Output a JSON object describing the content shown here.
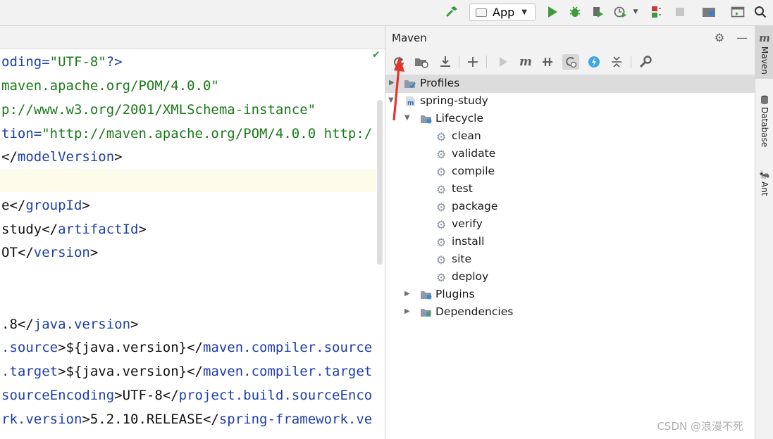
{
  "toolbar": {
    "run_config": "App"
  },
  "editor": {
    "lines": [
      [
        {
          "t": "tag",
          "v": "oding="
        },
        {
          "t": "str",
          "v": "\"UTF-8\""
        },
        {
          "t": "tag",
          "v": "?>"
        }
      ],
      [
        {
          "t": "str",
          "v": "maven.apache.org/POM/4.0.0\""
        }
      ],
      [
        {
          "t": "str",
          "v": "p://www.w3.org/2001/XMLSchema-instance\""
        }
      ],
      [
        {
          "t": "tag",
          "v": "tion="
        },
        {
          "t": "str",
          "v": "\"http://maven.apache.org/POM/4.0.0 http:/"
        }
      ],
      [
        {
          "t": "txt",
          "v": "</"
        },
        {
          "t": "tag",
          "v": "modelVersion"
        },
        {
          "t": "txt",
          "v": ">"
        }
      ],
      [
        {
          "t": "txt",
          "v": ""
        }
      ],
      [
        {
          "t": "txt",
          "v": "e</"
        },
        {
          "t": "tag",
          "v": "groupId"
        },
        {
          "t": "txt",
          "v": ">"
        }
      ],
      [
        {
          "t": "txt",
          "v": "study</"
        },
        {
          "t": "tag",
          "v": "artifactId"
        },
        {
          "t": "txt",
          "v": ">"
        }
      ],
      [
        {
          "t": "txt",
          "v": "OT</"
        },
        {
          "t": "tag",
          "v": "version"
        },
        {
          "t": "txt",
          "v": ">"
        }
      ],
      [
        {
          "t": "txt",
          "v": ""
        }
      ],
      [
        {
          "t": "txt",
          "v": ""
        }
      ],
      [
        {
          "t": "txt",
          "v": ".8</"
        },
        {
          "t": "tag",
          "v": "java.version"
        },
        {
          "t": "txt",
          "v": ">"
        }
      ],
      [
        {
          "t": "tag",
          "v": ".source"
        },
        {
          "t": "txt",
          "v": ">${java.version}</"
        },
        {
          "t": "tag",
          "v": "maven.compiler.source"
        }
      ],
      [
        {
          "t": "tag",
          "v": ".target"
        },
        {
          "t": "txt",
          "v": ">${java.version}</"
        },
        {
          "t": "tag",
          "v": "maven.compiler.target"
        }
      ],
      [
        {
          "t": "tag",
          "v": "sourceEncoding"
        },
        {
          "t": "txt",
          "v": ">UTF-8</"
        },
        {
          "t": "tag",
          "v": "project.build.sourceEnco"
        }
      ],
      [
        {
          "t": "tag",
          "v": "rk.version"
        },
        {
          "t": "txt",
          "v": ">5.2.10.RELEASE</"
        },
        {
          "t": "tag",
          "v": "spring-framework.ve"
        }
      ]
    ]
  },
  "maven": {
    "title": "Maven",
    "tree": {
      "profiles": "Profiles",
      "project": "spring-study",
      "lifecycle": "Lifecycle",
      "phases": [
        "clean",
        "validate",
        "compile",
        "test",
        "package",
        "verify",
        "install",
        "site",
        "deploy"
      ],
      "plugins": "Plugins",
      "dependencies": "Dependencies"
    }
  },
  "right_stripe": {
    "tabs": [
      "Maven",
      "Database",
      "Ant"
    ]
  },
  "watermark": "CSDN @浪漫不死"
}
